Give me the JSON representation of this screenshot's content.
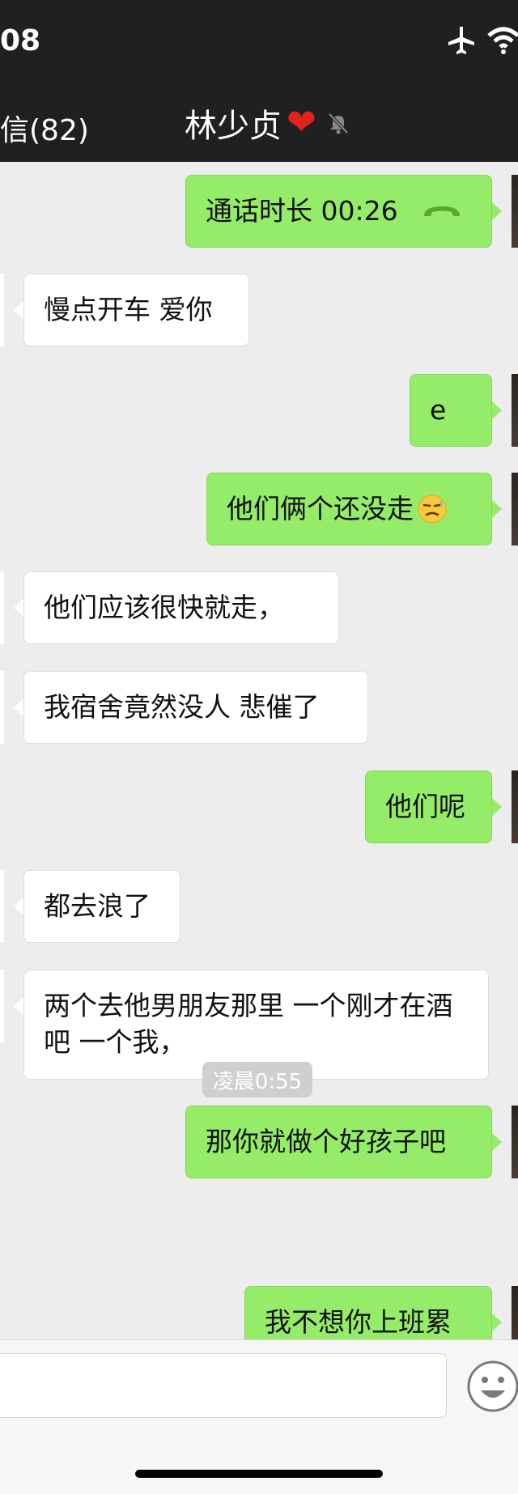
{
  "status_bar": {
    "time": "08"
  },
  "nav": {
    "back_label": "信(82)",
    "title": "林少贞"
  },
  "messages": [
    {
      "side": "out",
      "text": "通话时长 00:26"
    },
    {
      "side": "in",
      "text": "慢点开车 爱你"
    },
    {
      "side": "out",
      "text": "e"
    },
    {
      "side": "out",
      "text": "他们俩个还没走"
    },
    {
      "side": "in",
      "text": "他们应该很快就走，"
    },
    {
      "side": "in",
      "text": "我宿舍竟然没人 悲催了"
    },
    {
      "side": "out",
      "text": "他们呢"
    },
    {
      "side": "in",
      "text": "都去浪了"
    },
    {
      "side": "in",
      "text": "两个去他男朋友那里 一个刚才在酒吧 一个我，"
    },
    {
      "side": "out",
      "text": "那你就做个好孩子吧"
    },
    {
      "side": "out",
      "text": "我不想你上班累"
    }
  ],
  "timestamp": "凌晨0:55",
  "input": {
    "value": ""
  },
  "icons": {
    "status": [
      "airplane-icon",
      "wifi-icon"
    ],
    "nav": [
      "heart-icon",
      "mute-bell-icon"
    ],
    "call": "phone-hangup-icon",
    "emoji": "smirk-sweat-emoji-icon",
    "input": "emoji-button-icon"
  },
  "colors": {
    "outgoing_bubble": "#95ec69",
    "incoming_bubble": "#ffffff",
    "background": "#ededed",
    "header": "#202020"
  }
}
